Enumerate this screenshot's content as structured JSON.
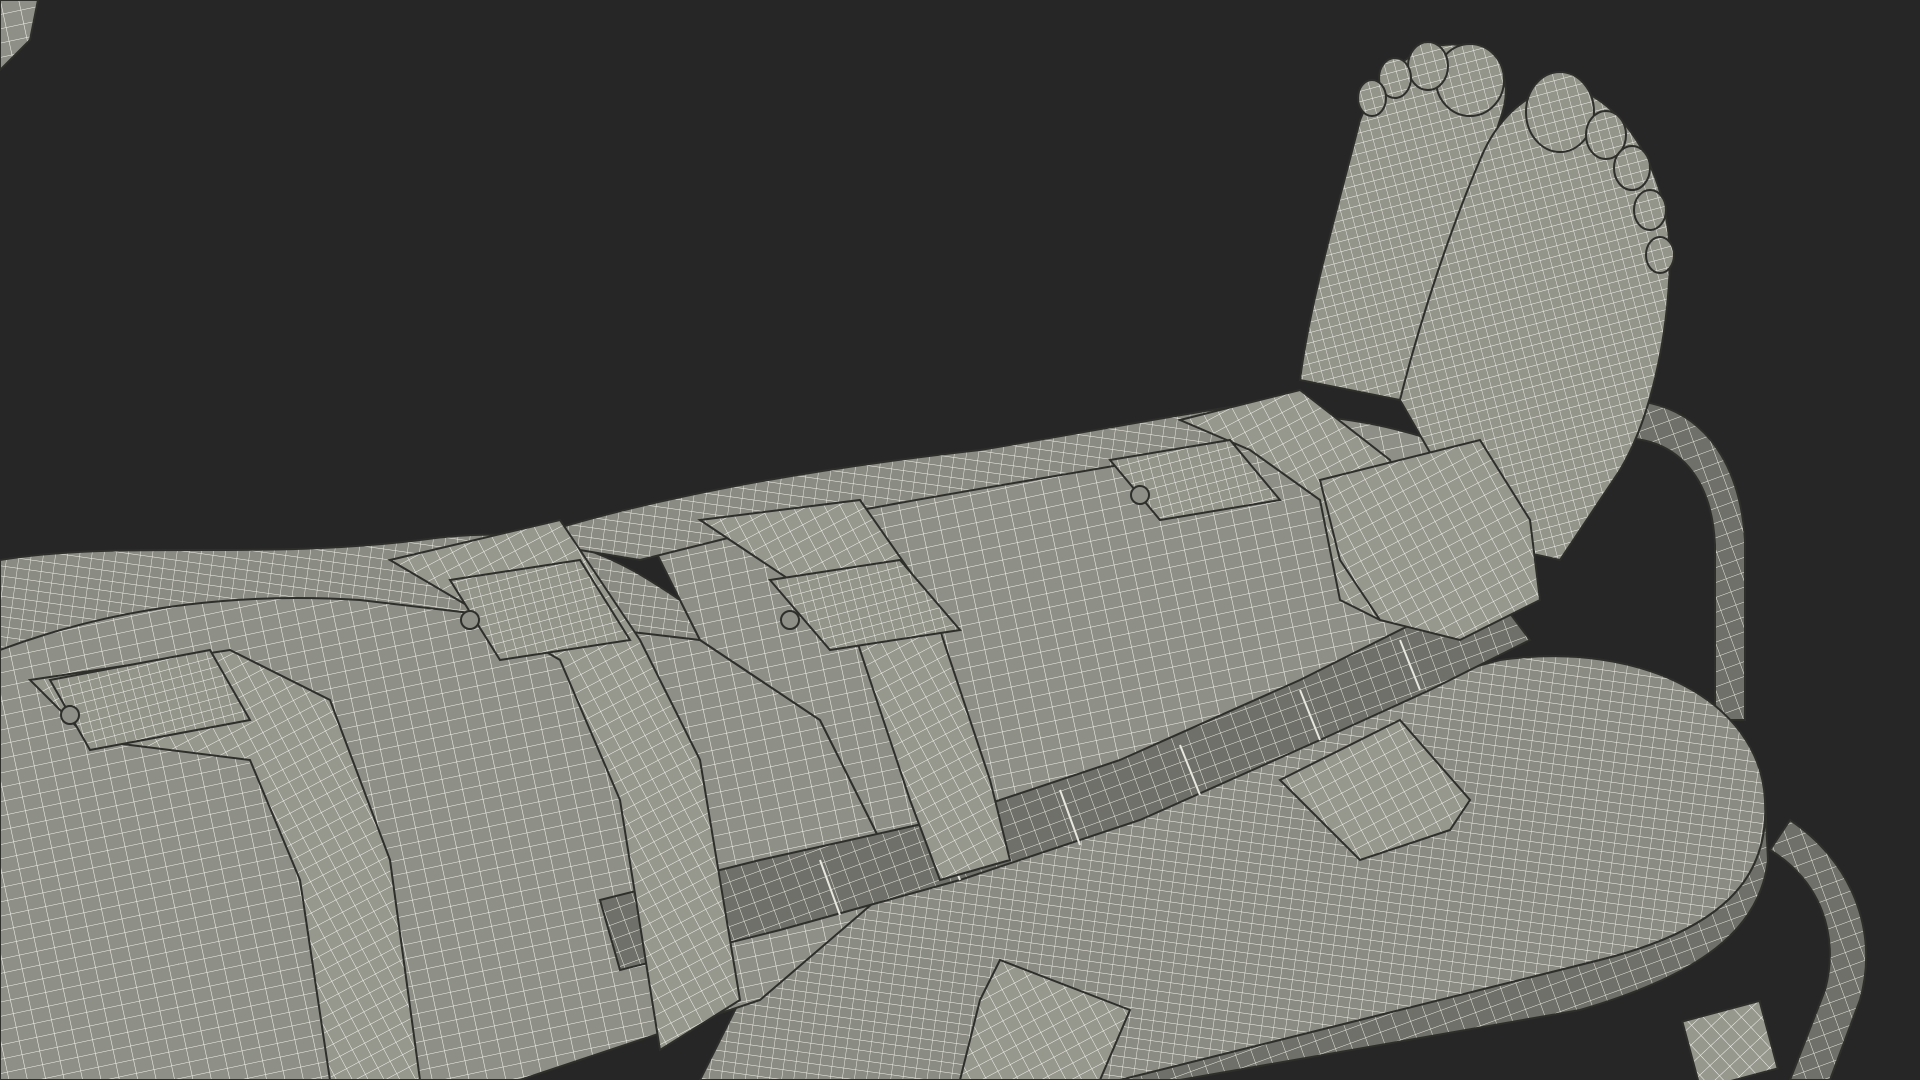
{
  "scene": {
    "subject": "wireframe-render",
    "colors": {
      "background": "#262626",
      "surface": "#8e8f86",
      "surface_dark": "#6f7069",
      "surface_light": "#a9aa9f",
      "wire": "#f4f4ee",
      "outline": "#2e2e2b"
    }
  }
}
